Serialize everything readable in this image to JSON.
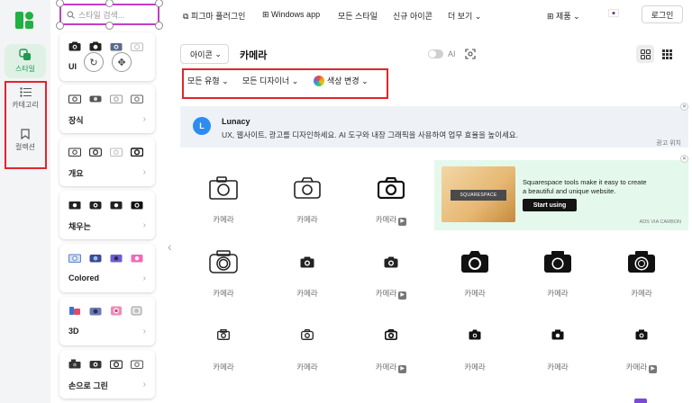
{
  "rail": {
    "items": [
      {
        "label": "스타일"
      },
      {
        "label": "카테고리"
      },
      {
        "label": "컬렉션"
      }
    ],
    "accent": "#1c9a52"
  },
  "panel": {
    "search_placeholder": "스타일 검색...",
    "styles": [
      {
        "name": "UI"
      },
      {
        "name": "장식"
      },
      {
        "name": "개요"
      },
      {
        "name": "채우는"
      },
      {
        "name": "Colored"
      },
      {
        "name": "3D"
      },
      {
        "name": "손으로 그린"
      }
    ],
    "rotate_glyph": "↻",
    "move_glyph": "✥"
  },
  "topnav": {
    "links": [
      "피그마 플러그인",
      "Windows app",
      "모든 스타일",
      "신규 아이콘",
      "더 보기"
    ],
    "products": "제품",
    "login": "로그인"
  },
  "searchbar": {
    "type": "아이콘",
    "query": "카메라",
    "ai": "AI"
  },
  "filters": {
    "style": "모든 유형",
    "designer": "모든 디자이너",
    "color": "색상 변경"
  },
  "ad": {
    "icon_letter": "L",
    "title": "Lunacy",
    "desc": "UX, 웹사이트, 광고를 디자인하세요. AI 도구와 내장 그래픽을 사용하여 업무 효율을 높이세요.",
    "footer": "광고 위치"
  },
  "carbon": {
    "brand": "SQUARESPACE",
    "text": "Squarespace tools make it easy to create a beautiful and unique website.",
    "cta": "Start using",
    "footer": "ADS VIA CARBON"
  },
  "icons": {
    "label": "카메라",
    "rows": [
      [
        "카메라",
        "카메라",
        "카메라"
      ],
      [
        "카메라",
        "카메라",
        "카메라",
        "카메라",
        "카메라",
        "카메라"
      ],
      [
        "카메라",
        "카메라",
        "카메라",
        "카메라",
        "카메라",
        "카메라"
      ]
    ]
  },
  "highlight_colors": {
    "red": "#e1252d",
    "magenta": "#c43cc7"
  }
}
